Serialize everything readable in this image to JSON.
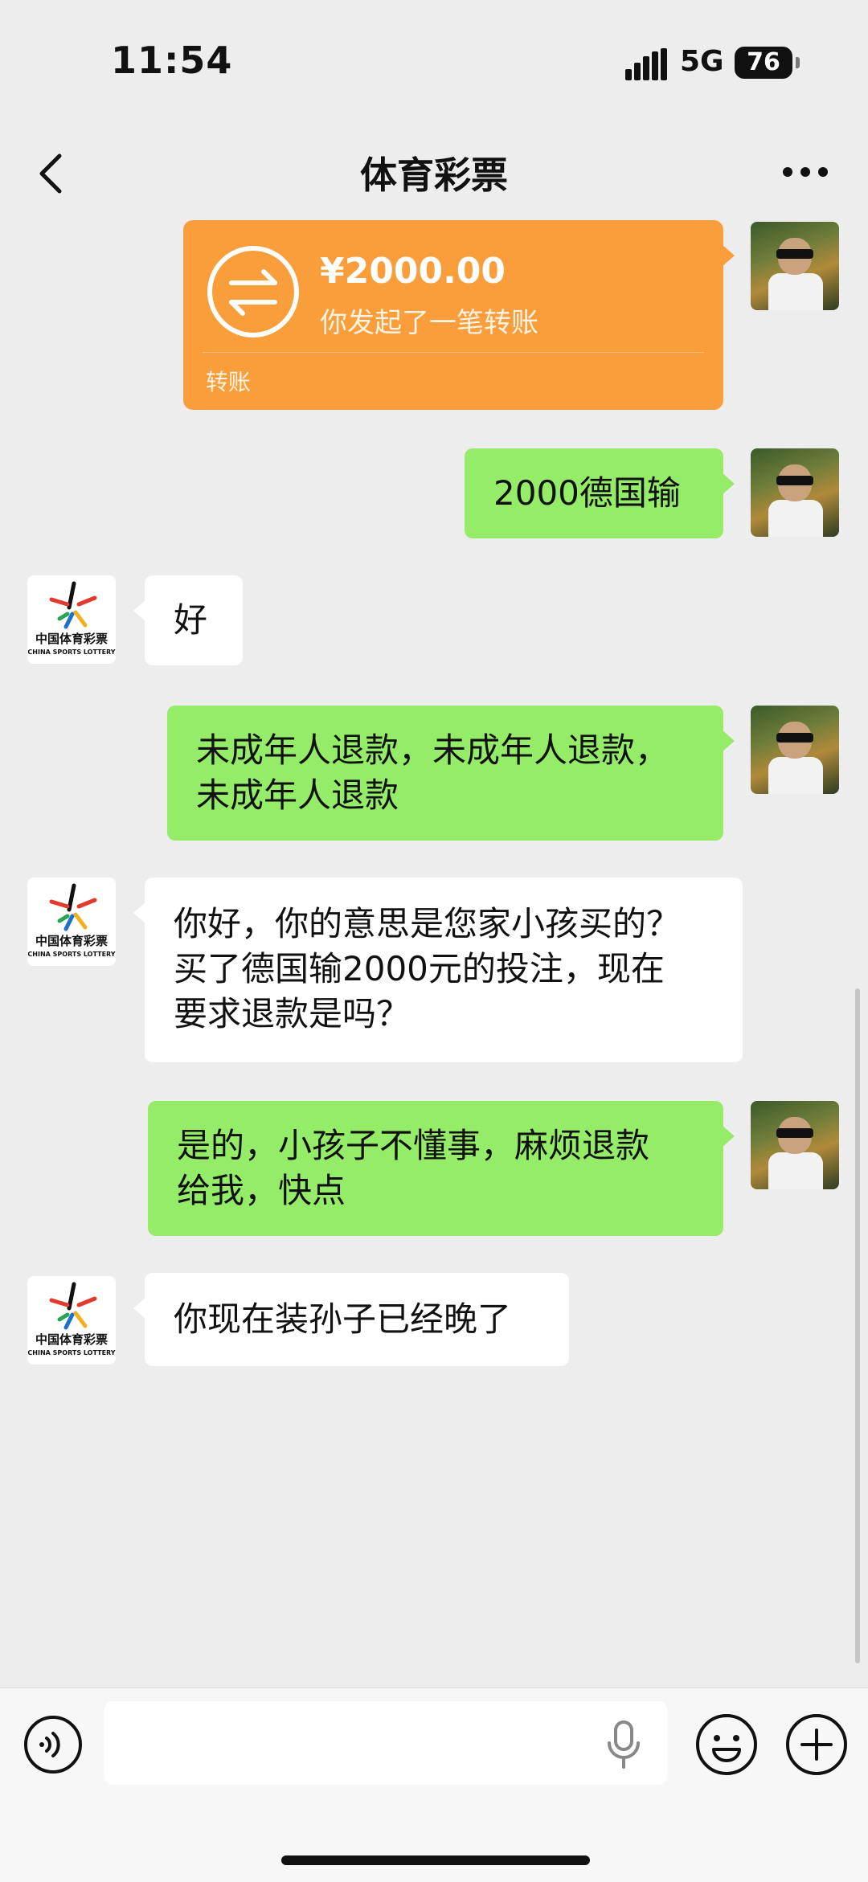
{
  "status_bar": {
    "time": "11:54",
    "network": "5G",
    "battery": "76"
  },
  "nav": {
    "title": "体育彩票"
  },
  "transfer": {
    "amount": "¥2000.00",
    "description": "你发起了一笔转账",
    "label": "转账"
  },
  "messages": [
    {
      "sender": "me",
      "text_lines": [
        "2000德国输"
      ]
    },
    {
      "sender": "lottery",
      "text_lines": [
        "好"
      ]
    },
    {
      "sender": "me",
      "text_lines": [
        "未成年人退款，未成年人退款，",
        "未成年人退款"
      ]
    },
    {
      "sender": "lottery",
      "text_lines": [
        "你好，你的意思是您家小孩买的？",
        "买了德国输2000元的投注，现在",
        "要求退款是吗？"
      ]
    },
    {
      "sender": "me",
      "text_lines": [
        "是的，小孩子不懂事，麻烦退款",
        "给我，快点"
      ]
    },
    {
      "sender": "lottery",
      "text_lines": [
        "你现在装孙子已经晚了"
      ]
    }
  ],
  "lottery_logo": {
    "cn": "中国体育彩票",
    "en": "CHINA SPORTS LOTTERY"
  },
  "colors": {
    "green_bubble": "#95ec69",
    "transfer_orange": "#fa9d3b",
    "background": "#ededed"
  },
  "icons": [
    "back-arrow-icon",
    "more-icon",
    "transfer-icon",
    "voice-icon",
    "mic-icon",
    "emoji-icon",
    "plus-icon"
  ]
}
